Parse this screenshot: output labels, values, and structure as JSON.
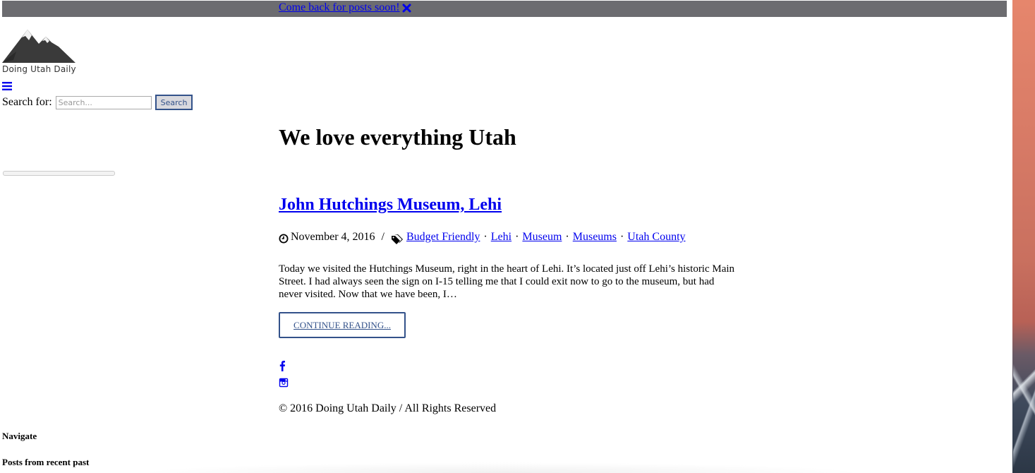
{
  "notice": {
    "link_text": "Come back for posts soon!",
    "close_icon": "close-x-icon"
  },
  "header": {
    "logo_text": "Doing Utah Daily",
    "menu_icon": "hamburger-icon"
  },
  "search": {
    "label": "Search for:",
    "placeholder": "Search...",
    "button_label": "Search"
  },
  "main": {
    "tagline": "We love everything Utah",
    "post": {
      "title": "John Hutchings Museum, Lehi",
      "date": "November 4, 2016",
      "separator": "/",
      "tags": [
        "Budget Friendly",
        "Lehi",
        "Museum",
        "Museums",
        "Utah County"
      ],
      "excerpt": "Today we visited the Hutchings Museum, right in the heart of Lehi. It’s located just off Lehi’s historic Main Street. I had always seen the sign on I-15 telling me that I could exit now to go to the museum, but had never visited. Now that we have been, I…",
      "continue_label": "CONTINUE READING..."
    }
  },
  "footer": {
    "social_icons": [
      "facebook-icon",
      "instagram-icon"
    ],
    "copyright": "© 2016 Doing Utah Daily / All Rights Reserved"
  },
  "sidebar": {
    "navigate_heading": "Navigate",
    "recent_heading": "Posts from recent past"
  },
  "colors": {
    "link": "#0000ee",
    "notice_bar": "#6c6c70",
    "button_accent": "#33528a"
  }
}
